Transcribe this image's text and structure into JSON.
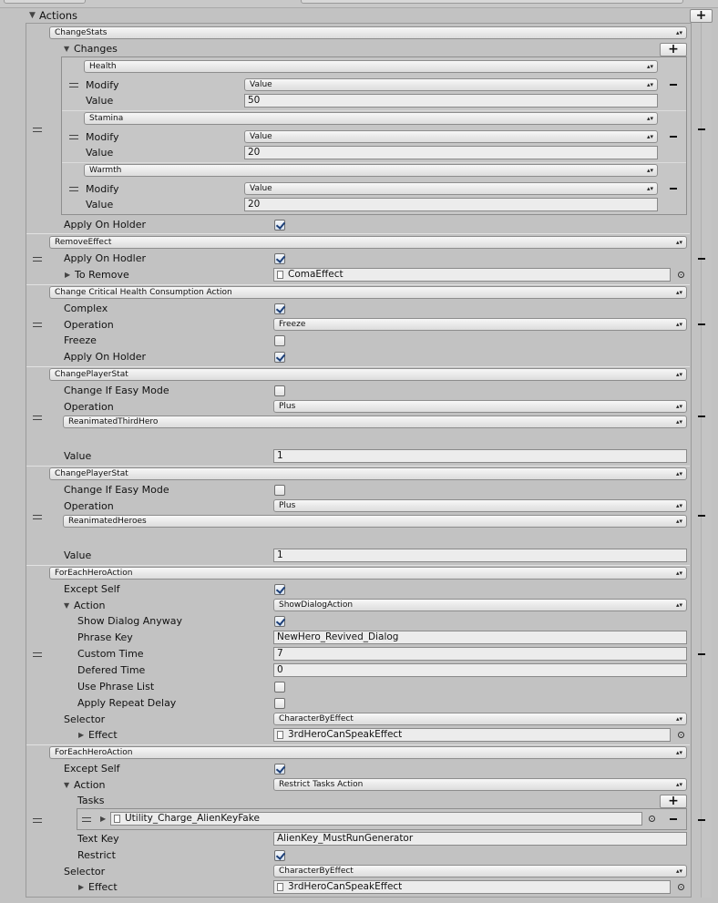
{
  "header": {
    "actions_label": "Actions",
    "add": "+"
  },
  "elements": [
    {
      "type": "ChangeStats",
      "changes_label": "Changes",
      "changes": [
        {
          "stat": "Health",
          "modify_label": "Modify",
          "modify_value": "Value",
          "value_label": "Value",
          "value": "50"
        },
        {
          "stat": "Stamina",
          "modify_label": "Modify",
          "modify_value": "Value",
          "value_label": "Value",
          "value": "20"
        },
        {
          "stat": "Warmth",
          "modify_label": "Modify",
          "modify_value": "Value",
          "value_label": "Value",
          "value": "20"
        }
      ],
      "apply_on_holder_label": "Apply On Holder",
      "apply_on_holder": true
    },
    {
      "type": "RemoveEffect",
      "apply_on_hodler_label": "Apply On Hodler",
      "apply_on_hodler": true,
      "to_remove_label": "To Remove",
      "to_remove_value": "ComaEffect"
    },
    {
      "type": "Change Critical Health Consumption Action",
      "complex_label": "Complex",
      "complex": true,
      "operation_label": "Operation",
      "operation_value": "Freeze",
      "freeze_label": "Freeze",
      "freeze": false,
      "apply_on_holder_label": "Apply On Holder",
      "apply_on_holder": true
    },
    {
      "type": "ChangePlayerStat",
      "change_if_easy_label": "Change If Easy Mode",
      "change_if_easy": false,
      "operation_label": "Operation",
      "operation_value": "Plus",
      "stat_value": "ReanimatedThirdHero",
      "value_label": "Value",
      "value": "1"
    },
    {
      "type": "ChangePlayerStat",
      "change_if_easy_label": "Change If Easy Mode",
      "change_if_easy": false,
      "operation_label": "Operation",
      "operation_value": "Plus",
      "stat_value": "ReanimatedHeroes",
      "value_label": "Value",
      "value": "1"
    },
    {
      "type": "ForEachHeroAction",
      "except_self_label": "Except Self",
      "except_self": true,
      "action_label": "Action",
      "action_value": "ShowDialogAction",
      "show_dialog_anyway_label": "Show Dialog Anyway",
      "show_dialog_anyway": true,
      "phrase_key_label": "Phrase Key",
      "phrase_key": "NewHero_Revived_Dialog",
      "custom_time_label": "Custom Time",
      "custom_time": "7",
      "defered_time_label": "Defered Time",
      "defered_time": "0",
      "use_phrase_list_label": "Use Phrase List",
      "use_phrase_list": false,
      "apply_repeat_delay_label": "Apply Repeat Delay",
      "apply_repeat_delay": false,
      "selector_label": "Selector",
      "selector_value": "CharacterByEffect",
      "effect_label": "Effect",
      "effect_value": "3rdHeroCanSpeakEffect"
    },
    {
      "type": "ForEachHeroAction",
      "except_self_label": "Except Self",
      "except_self": true,
      "action_label": "Action",
      "action_value": "Restrict Tasks Action",
      "tasks_label": "Tasks",
      "task_item": "Utility_Charge_AlienKeyFake",
      "text_key_label": "Text Key",
      "text_key": "AlienKey_MustRunGenerator",
      "restrict_label": "Restrict",
      "restrict": true,
      "selector_label": "Selector",
      "selector_value": "CharacterByEffect",
      "effect_label": "Effect",
      "effect_value": "3rdHeroCanSpeakEffect"
    }
  ]
}
